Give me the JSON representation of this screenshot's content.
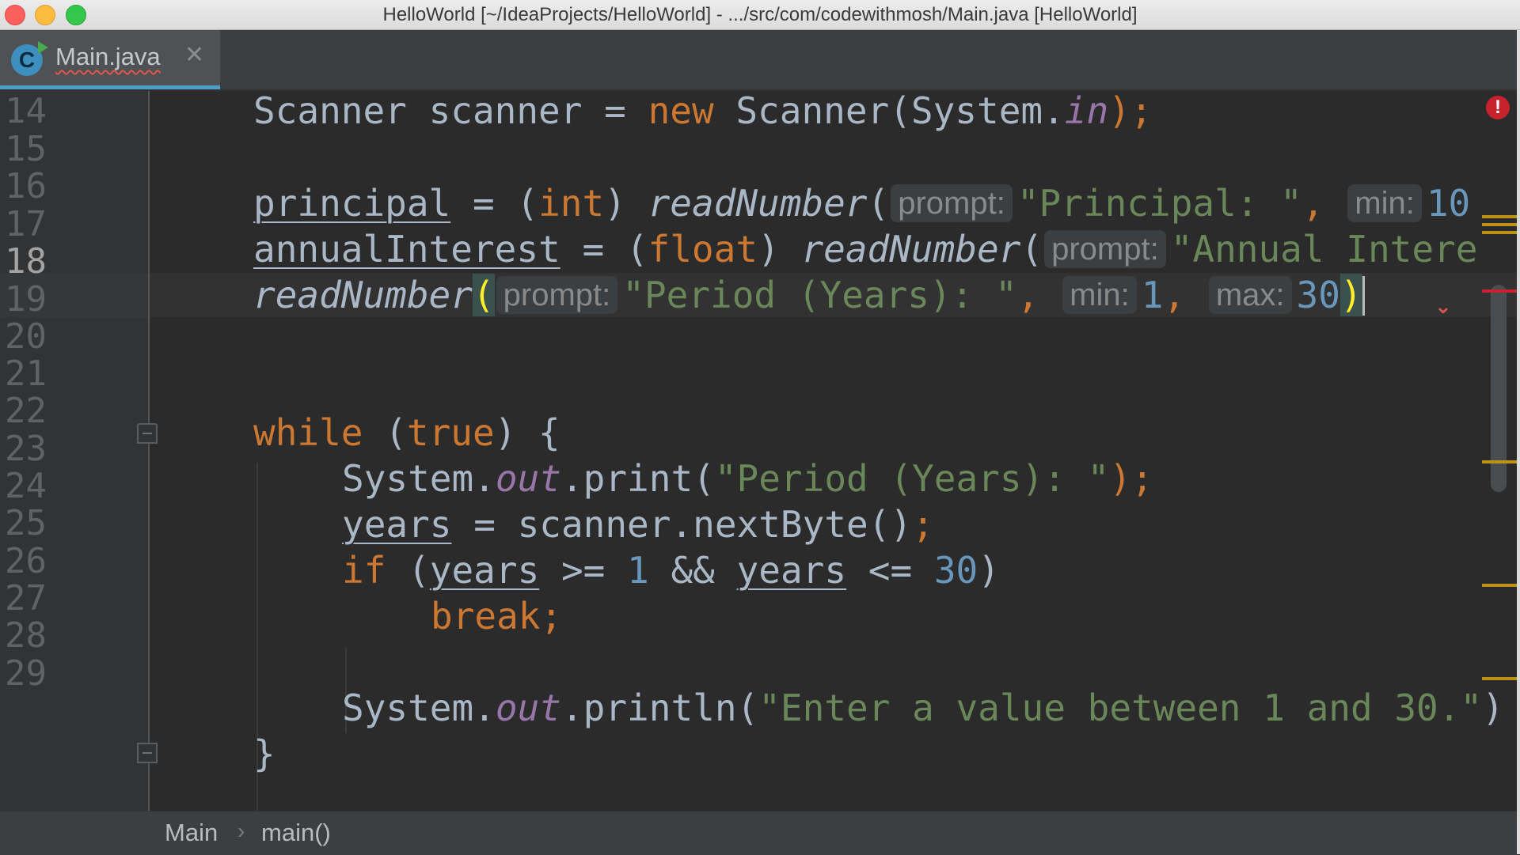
{
  "window": {
    "title": "HelloWorld [~/IdeaProjects/HelloWorld] - .../src/com/codewithmosh/Main.java [HelloWorld]"
  },
  "tab": {
    "icon_letter": "C",
    "label": "Main.java",
    "close": "✕"
  },
  "editor": {
    "current_line": "18",
    "line_numbers": [
      "14",
      "15",
      "16",
      "17",
      "18",
      "19",
      "20",
      "21",
      "22",
      "23",
      "24",
      "25",
      "26",
      "27",
      "28",
      "29"
    ],
    "hints": {
      "prompt": "prompt:",
      "min": "min:",
      "max": "max:"
    },
    "code": {
      "l14": {
        "type": "Scanner",
        "var": "scanner",
        "op": "=",
        "kw_new": "new",
        "ctor": "Scanner(System.",
        "field_in": "in",
        "end": ");"
      },
      "l16": {
        "var": "principal",
        "op": "=",
        "paren_open": "(",
        "cast": "int",
        "paren_close": ")",
        "method": "readNumber",
        "open": "(",
        "str": "\"Principal: \"",
        "comma": ",",
        "num_partial": "10"
      },
      "l17": {
        "var": "annualInterest",
        "op": "=",
        "paren_open": "(",
        "cast": "float",
        "paren_close": ")",
        "method": "readNumber",
        "open": "(",
        "str": "\"Annual Intere"
      },
      "l18": {
        "method": "readNumber",
        "open": "(",
        "str": "\"Period (Years): \"",
        "comma": ",",
        "min_val": "1",
        "comma2": ",",
        "max_val": "30",
        "close": ")"
      },
      "l21": {
        "kw_while": "while",
        "open": "(",
        "kw_true": "true",
        "close": ") {"
      },
      "l22": {
        "sys": "System.",
        "field_out": "out",
        "call": ".print(",
        "str": "\"Period (Years): \"",
        "end": ");"
      },
      "l23": {
        "var": "years",
        "rest": "= scanner.nextByte()",
        "semi": ";"
      },
      "l24": {
        "kw_if": "if",
        "open": "(",
        "var1": "years",
        "op1": ">=",
        "num1": "1",
        "and": "&&",
        "var2": "years",
        "op2": "<=",
        "num2": "30",
        "close": ")"
      },
      "l25": {
        "kw_break": "break;"
      },
      "l27": {
        "sys": "System.",
        "field_out": "out",
        "call": ".println(",
        "str": "\"Enter a value between 1 and 30.\"",
        "close": ")"
      },
      "l28": {
        "brace": "}"
      }
    }
  },
  "breadcrumb": {
    "class_name": "Main",
    "separator": "›",
    "method_name": "main()"
  },
  "indicators": {
    "error_sign": "!"
  }
}
